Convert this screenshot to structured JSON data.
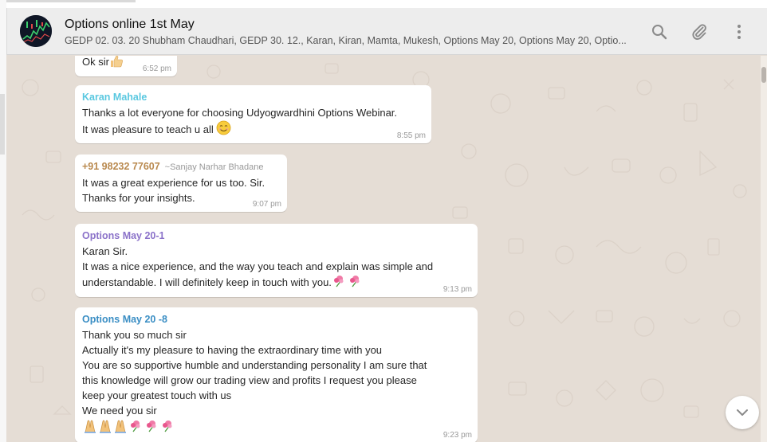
{
  "chat": {
    "title": "Options online 1st May",
    "participants": "GEDP 02. 03. 20 Shubham Chaudhari, GEDP 30. 12., Karan, Kiran, Mamta, Mukesh, Options May 20, Options May 20, Optio..."
  },
  "header_icons": [
    "search-icon",
    "paperclip-icon",
    "menu-icon"
  ],
  "messages": [
    {
      "lines": [
        "Ok sir"
      ],
      "emoji": "thumbs-up-icon",
      "time": "6:52 pm"
    },
    {
      "sender": "Karan Mahale",
      "sender_color": "#5ac8e0",
      "lines": [
        "Thanks a lot everyone for choosing Udyogwardhini Options Webinar.",
        "It was pleasure to teach u all"
      ],
      "emoji": "smiling-face-icon",
      "time": "8:55 pm"
    },
    {
      "sender": "+91 98232 77607",
      "sender_alias": "~Sanjay Narhar Bhadane",
      "sender_color": "#b9894e",
      "lines": [
        "It was a great experience for us too. Sir.",
        "Thanks for your insights."
      ],
      "time": "9:07 pm"
    },
    {
      "sender": "Options May 20-1",
      "sender_color": "#8b72c9",
      "lines": [
        "Karan Sir.",
        "It was a nice experience,  and the way you teach and explain was simple and",
        "understandable. I will definitely keep in touch with you."
      ],
      "emoji": "flowers-icon",
      "time": "9:13 pm"
    },
    {
      "sender": "Options May 20 -8",
      "sender_color": "#3a8ec4",
      "lines": [
        "Thank you so much sir",
        "Actually it's my pleasure to having the extraordinary time with you",
        "You are so supportive humble and understanding personality I am sure that",
        "this knowledge will grow our trading view and profits I request you please",
        "keep your greatest touch with us",
        "We need you sir"
      ],
      "emoji": "folded-hands-and-flowers-icon",
      "time": "9:23 pm"
    }
  ],
  "scroll_down_icon": "chevron-down-icon"
}
